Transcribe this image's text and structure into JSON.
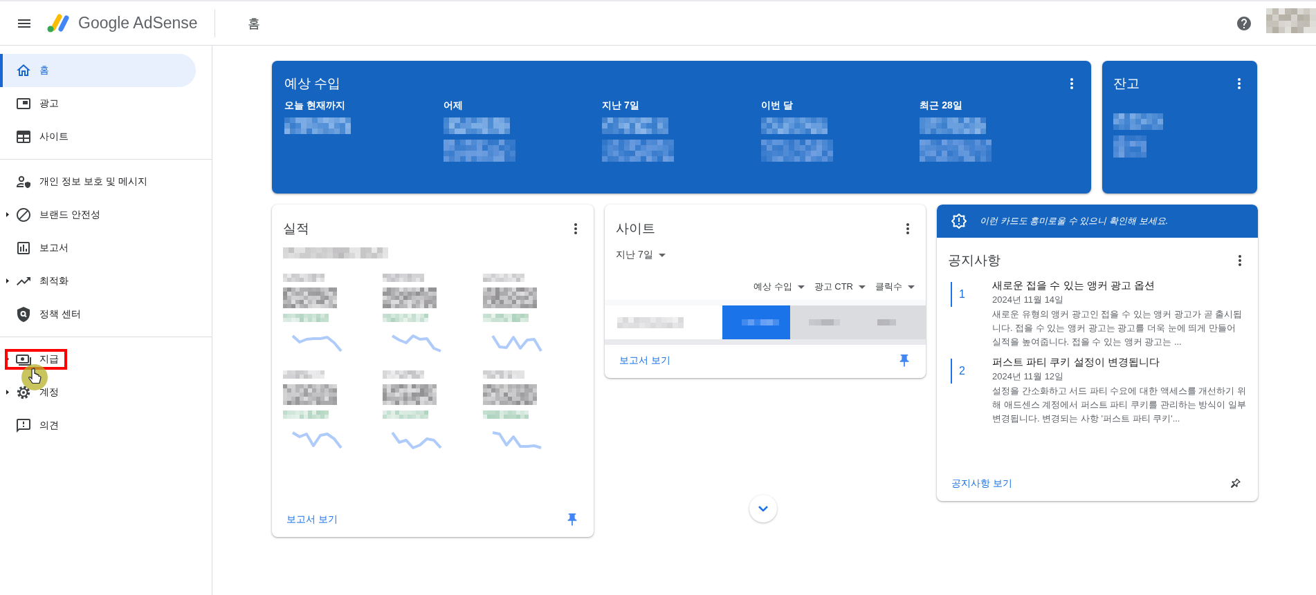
{
  "header": {
    "product_name": "Google AdSense",
    "page_title": "홈"
  },
  "sidebar": {
    "groups": [
      {
        "items": [
          {
            "label": "홈",
            "selected": true,
            "expandable": false,
            "annotated": false
          },
          {
            "label": "광고",
            "selected": false,
            "expandable": false,
            "annotated": false
          },
          {
            "label": "사이트",
            "selected": false,
            "expandable": false,
            "annotated": false
          }
        ]
      },
      {
        "items": [
          {
            "label": "개인 정보 보호 및 메시지",
            "selected": false,
            "expandable": false,
            "annotated": false
          },
          {
            "label": "브랜드 안전성",
            "selected": false,
            "expandable": true,
            "annotated": false
          },
          {
            "label": "보고서",
            "selected": false,
            "expandable": false,
            "annotated": false
          },
          {
            "label": "최적화",
            "selected": false,
            "expandable": true,
            "annotated": false
          },
          {
            "label": "정책 센터",
            "selected": false,
            "expandable": false,
            "annotated": false
          }
        ]
      },
      {
        "items": [
          {
            "label": "지급",
            "selected": false,
            "expandable": true,
            "annotated": true
          },
          {
            "label": "계정",
            "selected": false,
            "expandable": true,
            "annotated": false
          },
          {
            "label": "의견",
            "selected": false,
            "expandable": false,
            "annotated": false
          }
        ]
      }
    ]
  },
  "earnings": {
    "title": "예상 수입",
    "periods": [
      "오늘 현재까지",
      "어제",
      "지난 7일",
      "이번 달",
      "최근 28일"
    ]
  },
  "balance": {
    "title": "잔고"
  },
  "performance": {
    "title": "실적",
    "link": "보고서 보기"
  },
  "sites": {
    "title": "사이트",
    "range": "지난 7일",
    "columns": [
      "예상 수입",
      "광고 CTR",
      "클릭수"
    ],
    "link": "보고서 보기"
  },
  "notices": {
    "banner": "이런 카드도 흥미로울 수 있으니 확인해 보세요.",
    "title": "공지사항",
    "items": [
      {
        "number": "1",
        "title": "새로운 접을 수 있는 앵커 광고 옵션",
        "date": "2024년 11월 14일",
        "summary": "새로운 유형의 앵커 광고인 접을 수 있는 앵커 광고가 곧 출시됩니다. 접을 수 있는 앵커 광고는 광고를 더욱 눈에 띄게 만들어 실적을 높여줍니다. 접을 수 있는 앵커 광고는 ..."
      },
      {
        "number": "2",
        "title": "퍼스트 파티 쿠키 설정이 변경됩니다",
        "date": "2024년 11월 12일",
        "summary": "설정을 간소화하고 서드 파티 수요에 대한 액세스를 개선하기 위해 애드센스 계정에서 퍼스트 파티 쿠키를 관리하는 방식이 일부 변경됩니다. 변경되는 사항 '퍼스트 파티 쿠키'..."
      }
    ],
    "link": "공지사항 보기"
  }
}
